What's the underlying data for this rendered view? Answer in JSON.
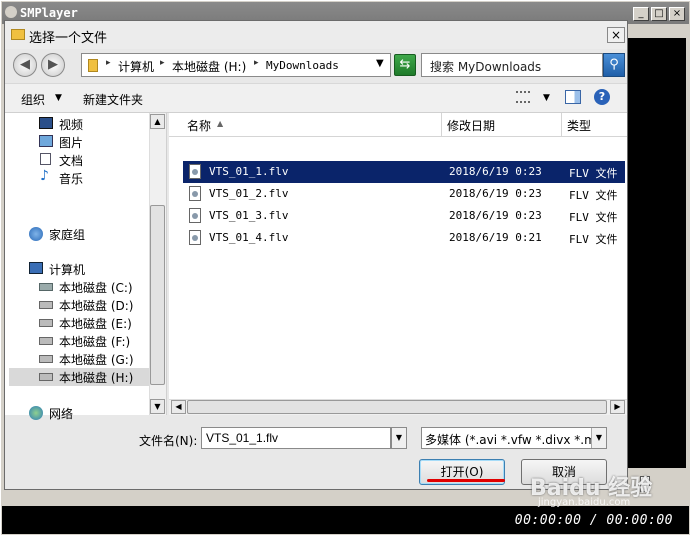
{
  "player": {
    "title": "SMPlayer",
    "minimize": "_",
    "maximize": "□",
    "close": "×",
    "time": "00:00:00 / 00:00:00"
  },
  "dialog": {
    "title": "选择一个文件",
    "close": "×",
    "nav": {
      "back": "◀",
      "forward": "▶",
      "crumbs": [
        "计算机",
        "本地磁盘 (H:)",
        "MyDownloads"
      ],
      "search_placeholder": "搜索 MyDownloads"
    },
    "toolbar": {
      "organize": "组织",
      "new_folder": "新建文件夹",
      "help": "?"
    },
    "navpane": {
      "items": [
        {
          "label": "视频",
          "icon": "video-icon"
        },
        {
          "label": "图片",
          "icon": "picture-icon"
        },
        {
          "label": "文档",
          "icon": "document-icon"
        },
        {
          "label": "音乐",
          "icon": "music-icon"
        },
        {
          "label": "家庭组",
          "icon": "homegroup-icon"
        },
        {
          "label": "计算机",
          "icon": "computer-icon"
        },
        {
          "label": "本地磁盘 (C:)",
          "icon": "drive-icon"
        },
        {
          "label": "本地磁盘 (D:)",
          "icon": "drive-icon"
        },
        {
          "label": "本地磁盘 (E:)",
          "icon": "drive-icon"
        },
        {
          "label": "本地磁盘 (F:)",
          "icon": "drive-icon"
        },
        {
          "label": "本地磁盘 (G:)",
          "icon": "drive-icon"
        },
        {
          "label": "本地磁盘 (H:)",
          "icon": "drive-icon",
          "selected": true
        },
        {
          "label": "网络",
          "icon": "network-icon"
        }
      ]
    },
    "filelist": {
      "columns": {
        "name": "名称",
        "modified": "修改日期",
        "type": "类型"
      },
      "rows": [
        {
          "name": "VTS_01_1.flv",
          "modified": "2018/6/19 0:23",
          "type": "FLV 文件",
          "selected": true
        },
        {
          "name": "VTS_01_2.flv",
          "modified": "2018/6/19 0:23",
          "type": "FLV 文件"
        },
        {
          "name": "VTS_01_3.flv",
          "modified": "2018/6/19 0:23",
          "type": "FLV 文件"
        },
        {
          "name": "VTS_01_4.flv",
          "modified": "2018/6/19 0:21",
          "type": "FLV 文件"
        }
      ]
    },
    "bottom": {
      "filename_label": "文件名(N):",
      "filename_value": "VTS_01_1.flv",
      "filetype_value": "多媒体 (*.avi *.vfw *.divx *.mp",
      "open": "打开(O)",
      "cancel": "取消"
    }
  },
  "watermark": {
    "brand": "Baidu 经验",
    "site": "jingyan.baidu.com"
  },
  "colors": {
    "selection": "#0a246a",
    "accent_underline": "#e00000"
  }
}
